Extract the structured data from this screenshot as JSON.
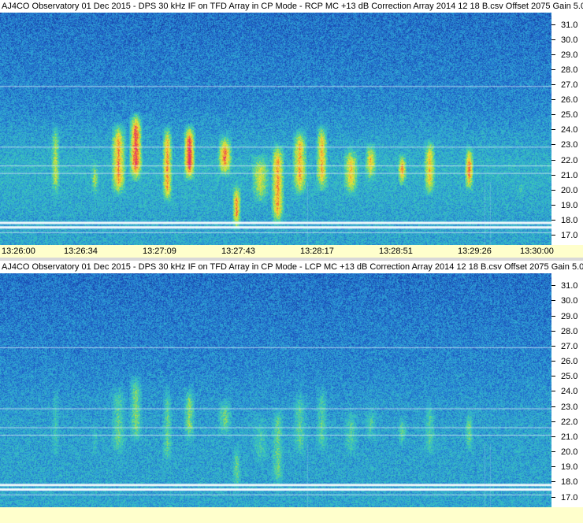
{
  "chart_data": [
    {
      "type": "heatmap",
      "title": "AJ4CO Observatory 01 Dec 2015 - DPS 30 kHz IF on TFD Array in CP Mode - RCP  MC +13 dB  Correction Array 2014 12 18 B.csv  Offset 2075  Gain 5.0",
      "x_tick_labels": [
        "13:26:00",
        "13:26:34",
        "13:27:09",
        "13:27:43",
        "13:28:17",
        "13:28:51",
        "13:29:26",
        "13:30:00"
      ],
      "y_tick_labels": [
        "31.0",
        "30.0",
        "29.0",
        "28.0",
        "27.0",
        "26.0",
        "25.0",
        "24.0",
        "23.0",
        "22.0",
        "21.0",
        "20.0",
        "19.0",
        "18.0",
        "17.0"
      ],
      "xlim": [
        "13:26:00",
        "13:30:00"
      ],
      "ylim": [
        16.3,
        31.8
      ],
      "polarization": "RCP",
      "burst_activity": "strong",
      "colormap": [
        "#0a1a6e",
        "#1f5fc8",
        "#2fa6d6",
        "#3fd0b0",
        "#b8e040",
        "#f5e040",
        "#f07830",
        "#e03070"
      ]
    },
    {
      "type": "heatmap",
      "title": "AJ4CO Observatory 01 Dec 2015 - DPS 30 kHz IF on TFD Array in CP Mode - LCP  MC +13 dB  Correction Array 2014 12 18 B.csv  Offset 2075  Gain 5.0",
      "x_tick_labels": [],
      "y_tick_labels": [
        "31.0",
        "30.0",
        "29.0",
        "28.0",
        "27.0",
        "26.0",
        "25.0",
        "24.0",
        "23.0",
        "22.0",
        "21.0",
        "20.0",
        "19.0",
        "18.0",
        "17.0"
      ],
      "xlim": [
        "13:26:00",
        "13:30:00"
      ],
      "ylim": [
        16.3,
        31.8
      ],
      "polarization": "LCP",
      "burst_activity": "weak",
      "colormap": [
        "#0a1a6e",
        "#1f5fc8",
        "#2fa6d6",
        "#3fd0b0",
        "#b8e040",
        "#f5e040",
        "#f07830",
        "#e03070"
      ]
    }
  ]
}
